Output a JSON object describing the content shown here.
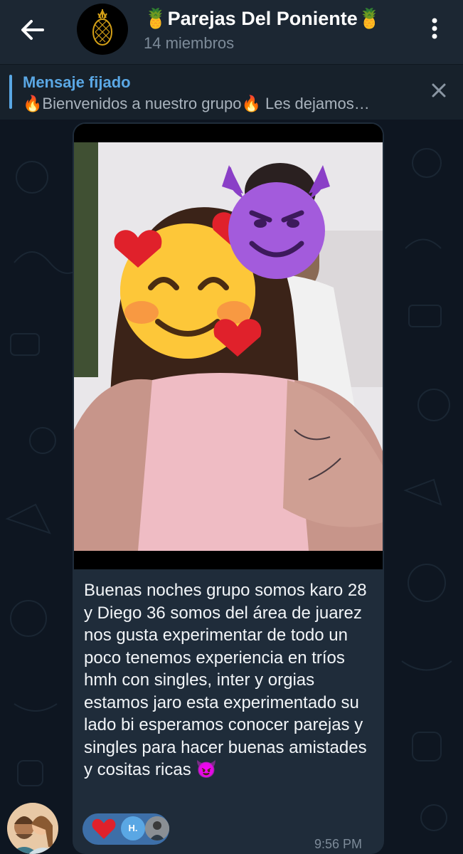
{
  "header": {
    "title": "🍍Parejas Del Poniente🍍",
    "subtitle": "14 miembros"
  },
  "pinned": {
    "title": "Mensaje fijado",
    "text": "🔥Bienvenidos a nuestro grupo🔥  Les dejamos…"
  },
  "message": {
    "text": "Buenas noches grupo somos karo 28 y Diego 36 somos del área de juarez nos gusta experimentar de todo un poco tenemos experiencia en tríos hmh con singles, inter y orgias estamos jaro esta experimentado su lado bi esperamos conocer parejas y singles para hacer buenas amistades y cositas ricas 😈",
    "time": "9:56 PM",
    "reaction_emoji": "heart",
    "reactor_initials": "H."
  },
  "colors": {
    "header_bg": "#1c2733",
    "chat_bg": "#0e1621",
    "bubble_bg": "#1f2c3a",
    "accent": "#5aa7e4",
    "reaction_bg": "#3d6fa8"
  },
  "icons": {
    "back": "arrow-left-icon",
    "menu": "more-vertical-icon",
    "close": "close-icon",
    "heart": "heart-icon"
  }
}
